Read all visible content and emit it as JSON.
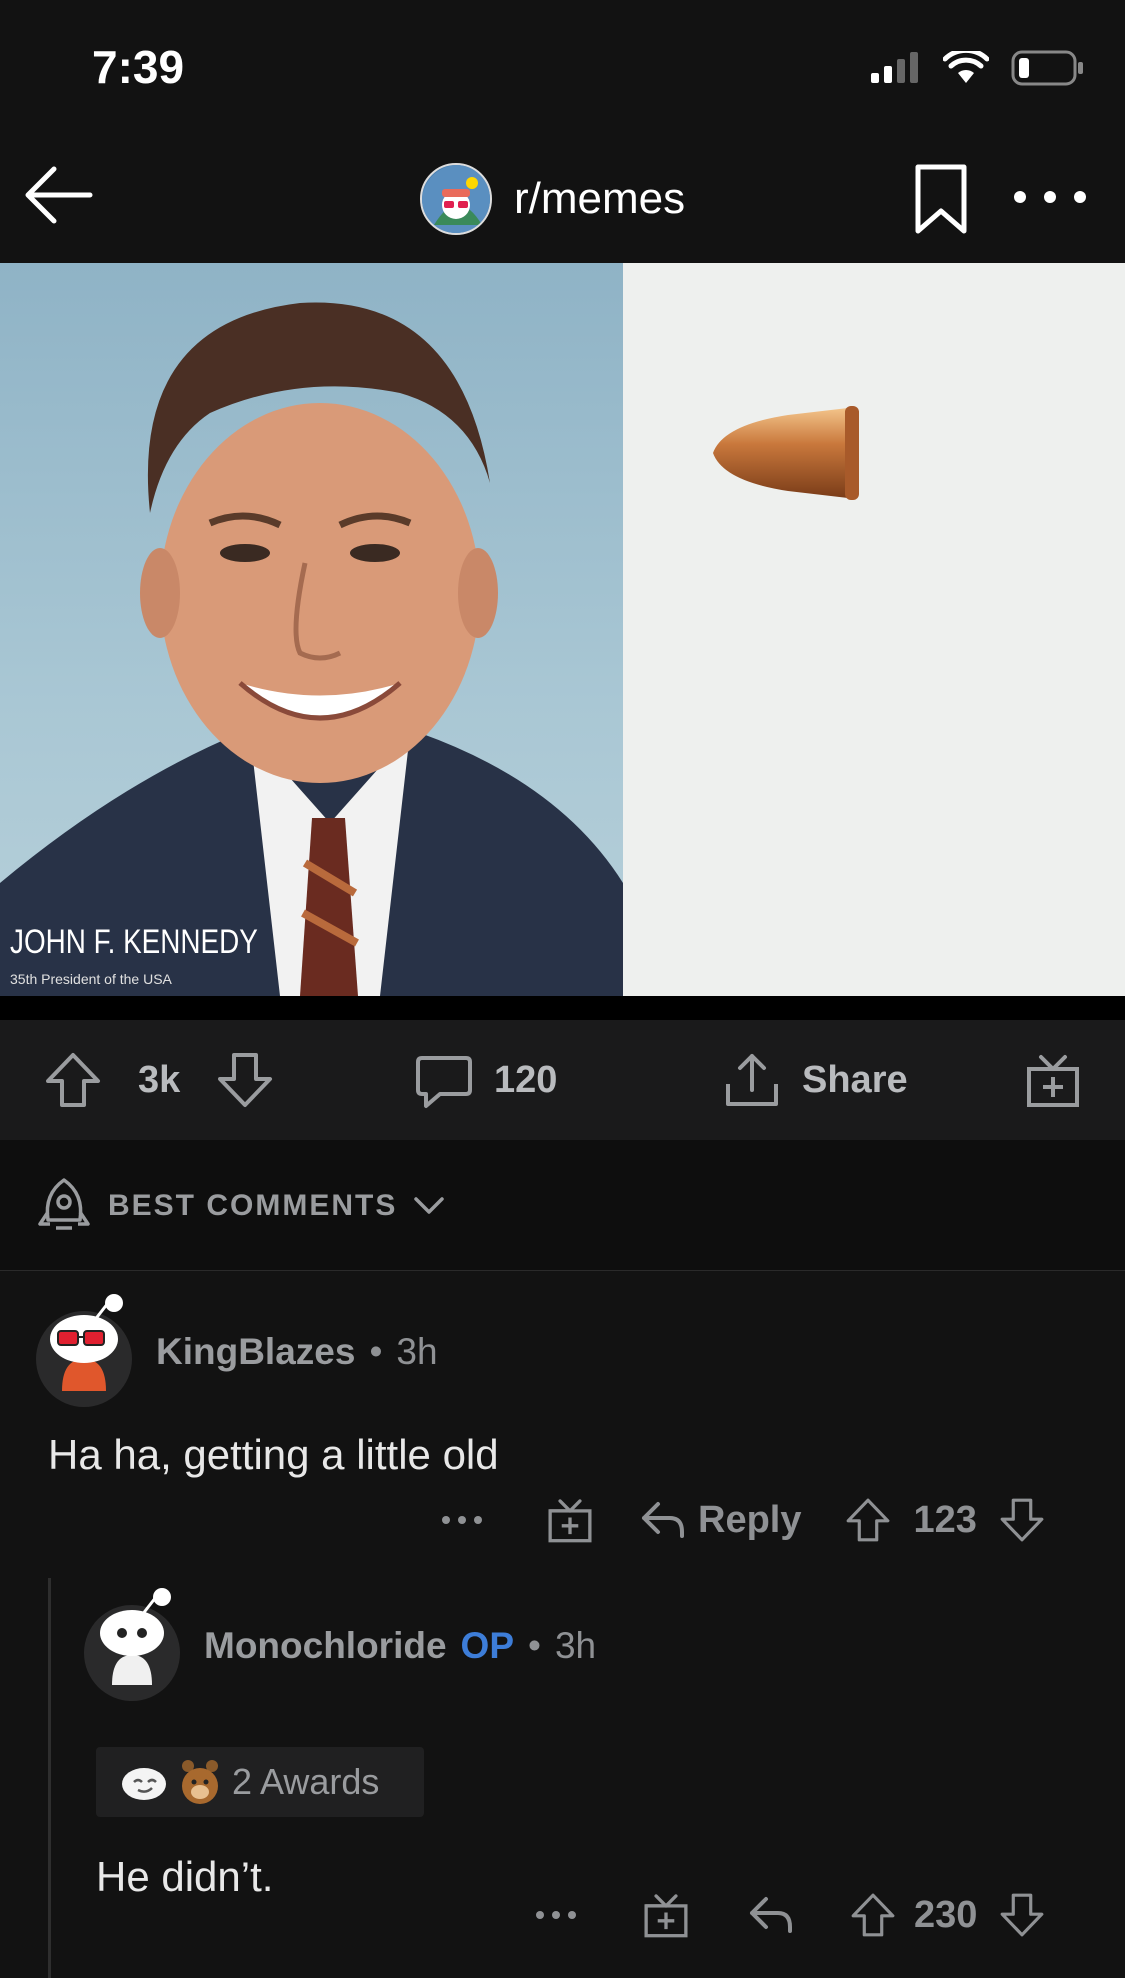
{
  "status_bar": {
    "time": "7:39"
  },
  "header": {
    "subreddit": "r/memes"
  },
  "post": {
    "image": {
      "caption_name": "JOHN F. KENNEDY",
      "caption_sub": "35th President of the USA"
    },
    "score": "3k",
    "comment_count": "120",
    "share_label": "Share"
  },
  "sort": {
    "label": "BEST COMMENTS"
  },
  "comments": [
    {
      "user": "KingBlazes",
      "time": "3h",
      "body": "Ha ha, getting a little old",
      "reply_label": "Reply",
      "score": "123"
    },
    {
      "user": "Monochloride",
      "op_badge": "OP",
      "time": "3h",
      "awards_label": "2 Awards",
      "body": "He didn’t.",
      "score": "230"
    }
  ],
  "colors": {
    "background": "#121212",
    "op_blue": "#3d7dd8",
    "muted": "#8f9194"
  }
}
